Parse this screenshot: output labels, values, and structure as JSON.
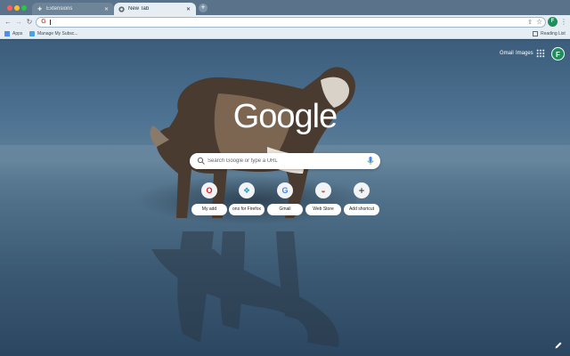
{
  "tabs": [
    {
      "label": "Extensions",
      "icon": "puzzle-icon",
      "active": false
    },
    {
      "label": "New Tab",
      "icon": "chrome-icon",
      "active": true
    }
  ],
  "bookmarks": {
    "apps_label": "Apps",
    "manage_label": "Manage My Subsc...",
    "reading_list_label": "Reading List"
  },
  "profile_initial": "F",
  "google": {
    "gmail_label": "Gmail",
    "images_label": "Images",
    "logo_text": "Google",
    "search_placeholder": "Search Google or type a URL"
  },
  "shortcuts": [
    {
      "label": "My add",
      "icon_char": "O",
      "icon_color": "#e01b22"
    },
    {
      "label": "ons for Firefox",
      "icon_char": "❖",
      "icon_color": "#1aa6c4"
    },
    {
      "label": "Gmail",
      "icon_char": "G",
      "icon_color": "#4285f4"
    },
    {
      "label": "Web Store",
      "icon_char": "◒",
      "icon_color": "#db4437"
    },
    {
      "label": "Add shortcut",
      "icon_char": "+",
      "icon_color": "#202124"
    }
  ],
  "colors": {
    "accent": "#1e8e5a",
    "chrome_bg": "#e6eef4",
    "tabstrip_bg": "#5a738a"
  }
}
